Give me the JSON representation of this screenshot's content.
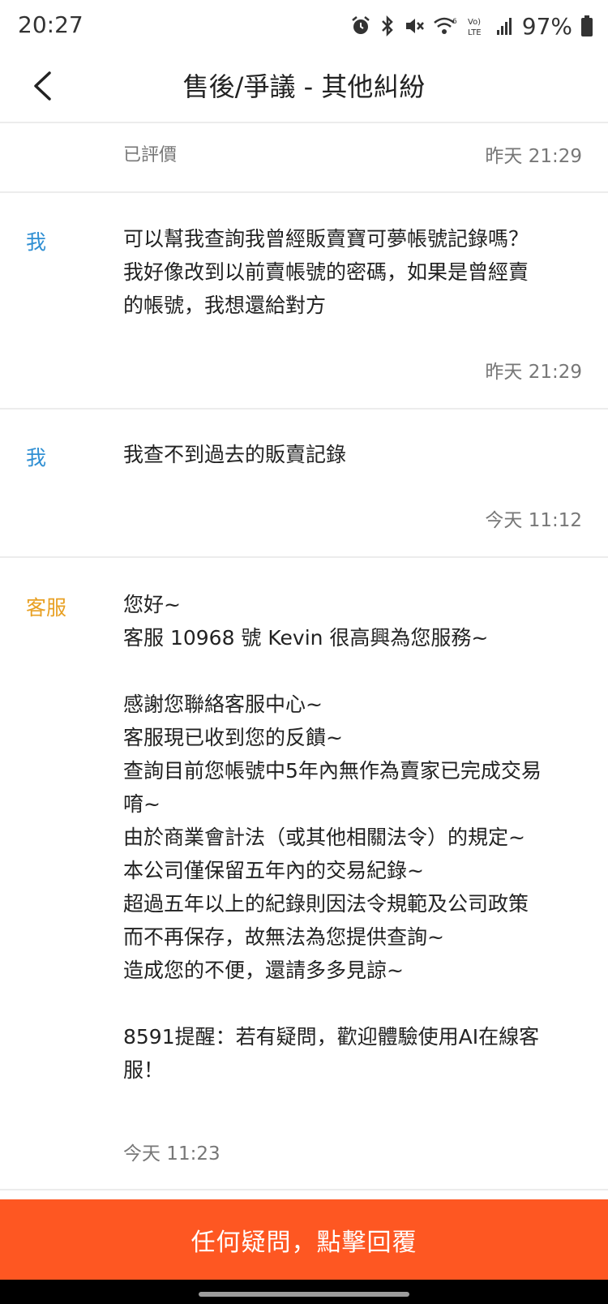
{
  "status_bar": {
    "time": "20:27",
    "battery": "97%",
    "icons": [
      "alarm-icon",
      "bluetooth-icon",
      "mute-icon",
      "wifi-icon",
      "volte-icon",
      "signal-icon",
      "battery-icon"
    ]
  },
  "header": {
    "back_icon": "chevron-left-icon",
    "title": "售後/爭議 - 其他糾紛"
  },
  "messages": [
    {
      "rated": "已評價",
      "time": "昨天 21:29"
    },
    {
      "sender": "我",
      "text": "可以幫我查詢我曾經販賣寶可夢帳號記錄嗎？\n我好像改到以前賣帳號的密碼，如果是曾經賣\n的帳號，我想還給對方",
      "time": "昨天 21:29"
    },
    {
      "sender": "我",
      "text": "我查不到過去的販賣記錄",
      "time": "今天 11:12"
    },
    {
      "sender": "客服",
      "text": "您好~\n客服 10968 號 Kevin 很高興為您服務~\n\n感謝您聯絡客服中心~\n客服現已收到您的反饋~\n查詢目前您帳號中5年內無作為賣家已完成交易\n唷~\n由於商業會計法（或其他相關法令）的規定~\n本公司僅保留五年內的交易紀錄~\n超過五年以上的紀錄則因法令規範及公司政策\n而不再保存，故無法為您提供查詢~\n造成您的不便，還請多多見諒~\n\n8591提醒：若有疑問，歡迎體驗使用AI在線客\n服！",
      "time": "今天 11:23"
    }
  ],
  "reply_button": {
    "label": "任何疑問，點擊回覆"
  },
  "colors": {
    "accent": "#fe5722",
    "me": "#2f8fd3",
    "support": "#e8a023"
  }
}
